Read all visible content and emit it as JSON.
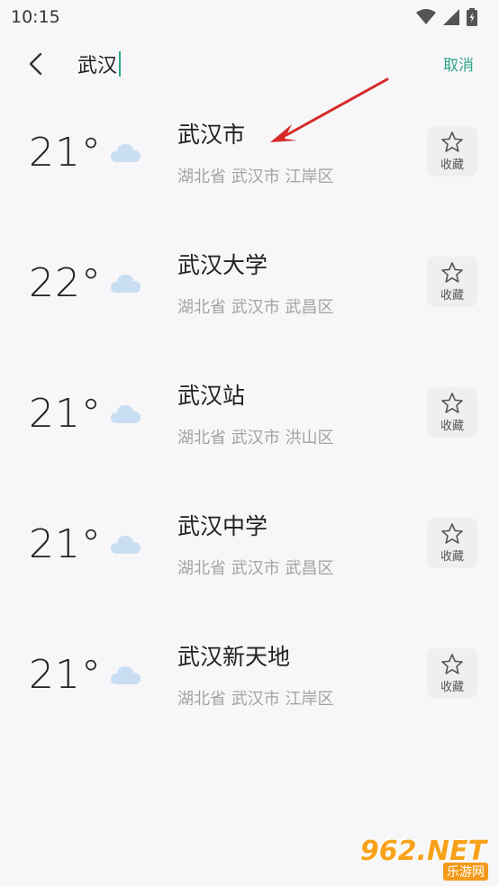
{
  "status_bar": {
    "time": "10:15",
    "icons": [
      "wifi-icon",
      "signal-icon",
      "battery-icon"
    ]
  },
  "search": {
    "query": "武汉",
    "cancel_label": "取消",
    "accent_color": "#2fa58a"
  },
  "results": [
    {
      "temp": "21°",
      "weather_icon": "cloud-icon",
      "name": "武汉市",
      "location": "湖北省 武汉市 江岸区",
      "fav_label": "收藏"
    },
    {
      "temp": "22°",
      "weather_icon": "cloud-icon",
      "name": "武汉大学",
      "location": "湖北省 武汉市 武昌区",
      "fav_label": "收藏"
    },
    {
      "temp": "21°",
      "weather_icon": "cloud-icon",
      "name": "武汉站",
      "location": "湖北省 武汉市 洪山区",
      "fav_label": "收藏"
    },
    {
      "temp": "21°",
      "weather_icon": "cloud-icon",
      "name": "武汉中学",
      "location": "湖北省 武汉市 武昌区",
      "fav_label": "收藏"
    },
    {
      "temp": "21°",
      "weather_icon": "cloud-icon",
      "name": "武汉新天地",
      "location": "湖北省 武汉市 江岸区",
      "fav_label": "收藏"
    }
  ],
  "watermark": {
    "main": "962.NET",
    "sub": "乐游网"
  }
}
